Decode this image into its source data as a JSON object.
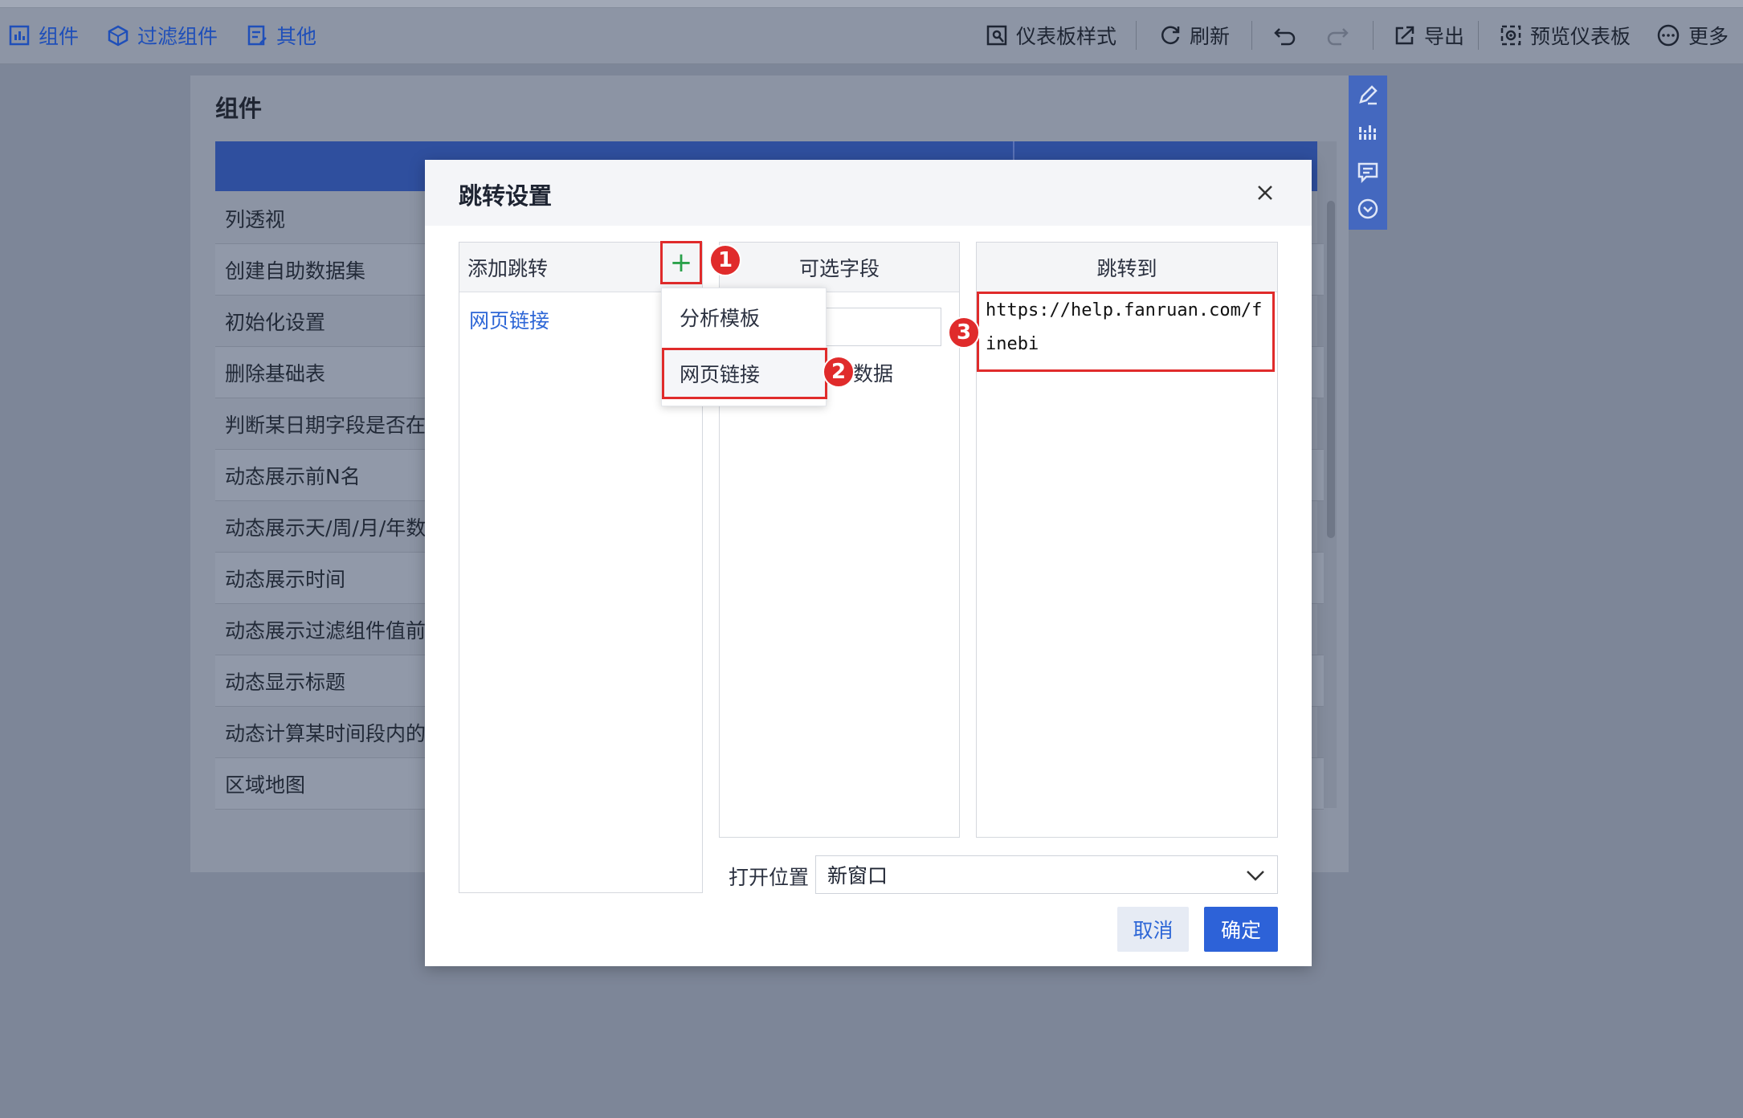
{
  "toolbar": {
    "left": [
      "组件",
      "过滤组件",
      "其他"
    ],
    "right": [
      "仪表板样式",
      "刷新",
      "导出",
      "预览仪表板",
      "更多"
    ]
  },
  "panel": {
    "title": "组件",
    "rows": [
      "列透视",
      "创建自助数据集",
      "初始化设置",
      "删除基础表",
      "判断某日期字段是否在打",
      "动态展示前N名",
      "动态展示天/周/月/年数据",
      "动态展示时间",
      "动态展示过滤组件值前后",
      "动态显示标题",
      "动态计算某时间段内的新",
      "区域地图"
    ]
  },
  "modal": {
    "title": "跳转设置",
    "col1_header": "添加跳转",
    "col1_item": "网页链接",
    "col2_header": "可选字段",
    "col2_field": "数据",
    "col3_header": "跳转到",
    "url": "https://help.fanruan.com/finebi",
    "dropdown": [
      "分析模板",
      "网页链接"
    ],
    "open_label": "打开位置",
    "open_value": "新窗口",
    "cancel": "取消",
    "ok": "确定"
  },
  "badges": [
    "1",
    "2",
    "3"
  ],
  "colors": {
    "accent": "#2d62d8",
    "highlight": "#e02b2b",
    "add": "#2aa14b"
  }
}
